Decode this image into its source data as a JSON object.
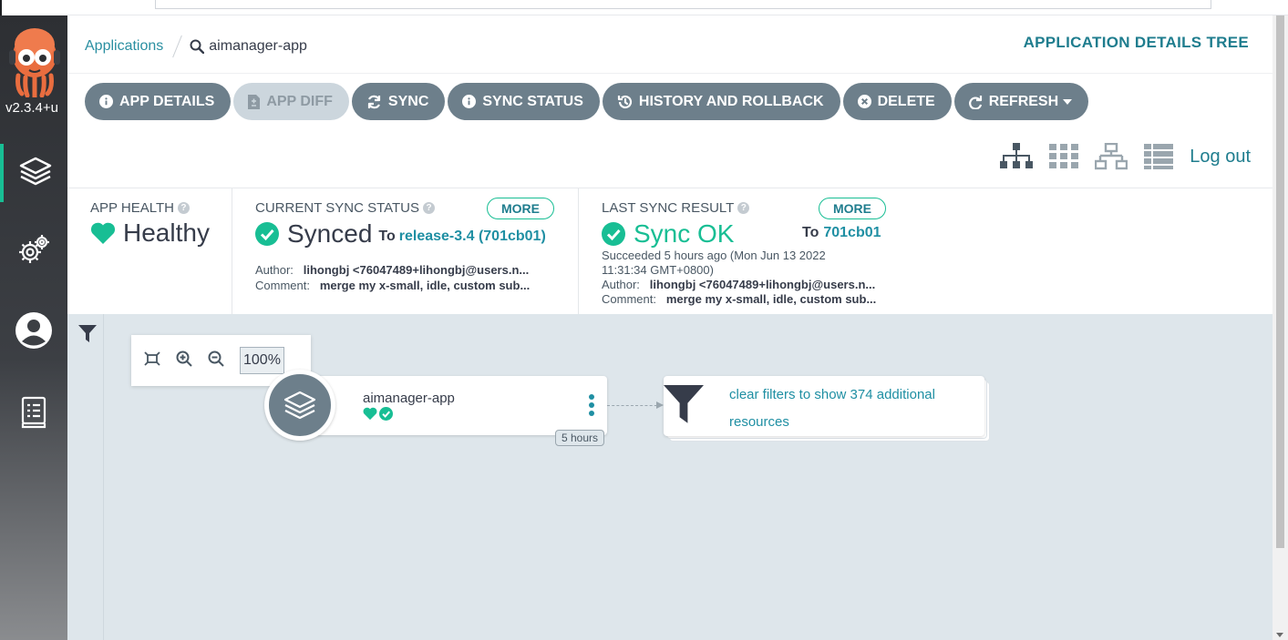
{
  "sidebar": {
    "version": "v2.3.4+u",
    "items": [
      {
        "name": "applications",
        "icon": "layers-icon"
      },
      {
        "name": "settings",
        "icon": "gears-icon"
      },
      {
        "name": "user-info",
        "icon": "user-circle-icon"
      },
      {
        "name": "documentation",
        "icon": "docs-icon"
      }
    ]
  },
  "header": {
    "breadcrumb_root": "Applications",
    "breadcrumb_current": "aimanager-app",
    "title": "APPLICATION DETAILS TREE"
  },
  "toolbar": {
    "buttons": [
      {
        "label": "APP DETAILS",
        "icon": "info-icon"
      },
      {
        "label": "APP DIFF",
        "icon": "file-diff-icon",
        "disabled": true
      },
      {
        "label": "SYNC",
        "icon": "sync-icon"
      },
      {
        "label": "SYNC STATUS",
        "icon": "info-icon"
      },
      {
        "label": "HISTORY AND ROLLBACK",
        "icon": "history-icon"
      },
      {
        "label": "DELETE",
        "icon": "times-circle-icon"
      },
      {
        "label": "REFRESH",
        "icon": "redo-icon"
      }
    ],
    "views": [
      "tree-view-icon",
      "pods-view-icon",
      "network-view-icon",
      "list-view-icon"
    ],
    "logout": "Log out"
  },
  "status": {
    "health": {
      "label": "APP HEALTH",
      "value": "Healthy"
    },
    "sync": {
      "label": "CURRENT SYNC STATUS",
      "more": "MORE",
      "value": "Synced",
      "to_prefix": "To",
      "revision": "release-3.4 (701cb01)",
      "author_label": "Author:",
      "author": "lihongbj <76047489+lihongbj@users.n...",
      "comment_label": "Comment:",
      "comment": "merge my x-small, idle, custom sub..."
    },
    "last_sync": {
      "label": "LAST SYNC RESULT",
      "more": "MORE",
      "value": "Sync OK",
      "to_prefix": "To",
      "revision": "701cb01",
      "succeeded_line1": "Succeeded 5 hours ago (Mon Jun 13 2022",
      "succeeded_line2": "11:31:34 GMT+0800)",
      "author_label": "Author:",
      "author": "lihongbj <76047489+lihongbj@users.n...",
      "comment_label": "Comment:",
      "comment": "merge my x-small, idle, custom sub..."
    }
  },
  "graph": {
    "zoom_level": "100%",
    "app_node": {
      "name": "aimanager-app",
      "age": "5 hours"
    },
    "filter_node": {
      "text": "clear filters to show 374 additional resources"
    }
  },
  "colors": {
    "accent": "#18be94",
    "teal": "#1f8fa3",
    "button": "#6d7f8b",
    "graph_bg": "#dee6eb"
  }
}
